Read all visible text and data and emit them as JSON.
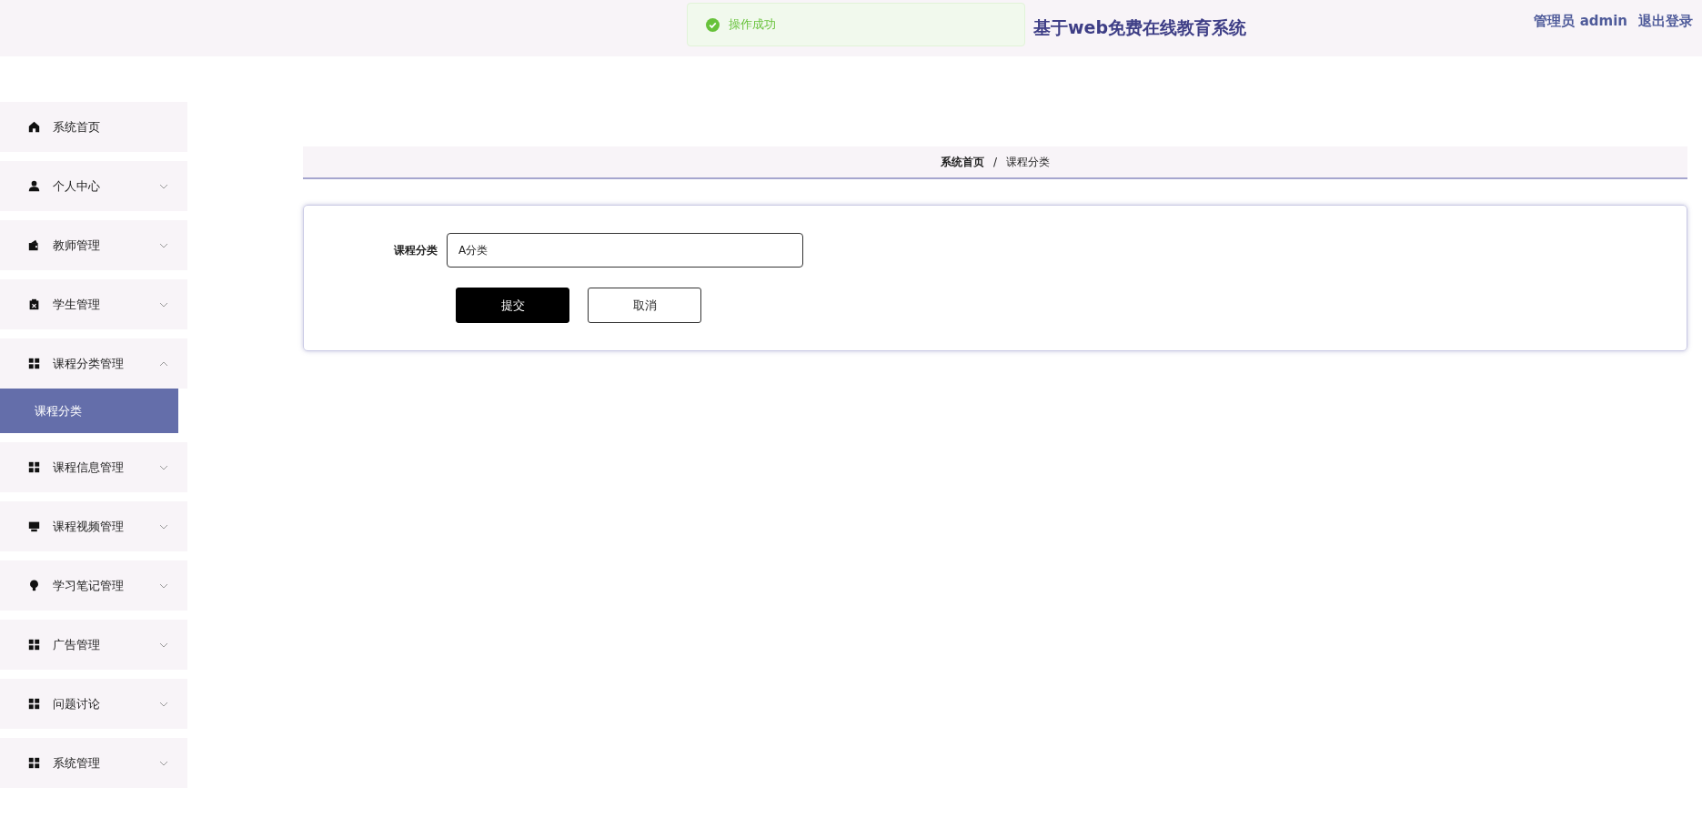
{
  "header": {
    "title": "基于web免费在线教育系统",
    "user": "管理员 admin",
    "logout": "退出登录"
  },
  "toast": {
    "kind": "success",
    "message": "操作成功"
  },
  "sidebar": {
    "items": [
      {
        "kind": "home",
        "label": "系统首页"
      },
      {
        "kind": "user",
        "label": "个人中心",
        "expanded": false
      },
      {
        "kind": "wallet",
        "label": "教师管理",
        "expanded": false
      },
      {
        "kind": "clipboard",
        "label": "学生管理",
        "expanded": false
      },
      {
        "kind": "grid",
        "label": "课程分类管理",
        "expanded": true,
        "children": [
          {
            "label": "课程分类",
            "selected": true
          }
        ]
      },
      {
        "kind": "grid",
        "label": "课程信息管理",
        "expanded": false
      },
      {
        "kind": "monitor",
        "label": "课程视频管理",
        "expanded": false
      },
      {
        "kind": "bulb",
        "label": "学习笔记管理",
        "expanded": false
      },
      {
        "kind": "grid",
        "label": "广告管理",
        "expanded": false
      },
      {
        "kind": "grid",
        "label": "问题讨论",
        "expanded": false
      },
      {
        "kind": "grid",
        "label": "系统管理",
        "expanded": false
      }
    ]
  },
  "breadcrumb": {
    "items": [
      "系统首页",
      "课程分类"
    ],
    "separator": "/"
  },
  "form": {
    "fields": [
      {
        "label": "课程分类",
        "value": "A分类"
      }
    ],
    "buttons": [
      {
        "kind": "primary",
        "label": "提交"
      },
      {
        "kind": "default",
        "label": "取消"
      }
    ]
  }
}
